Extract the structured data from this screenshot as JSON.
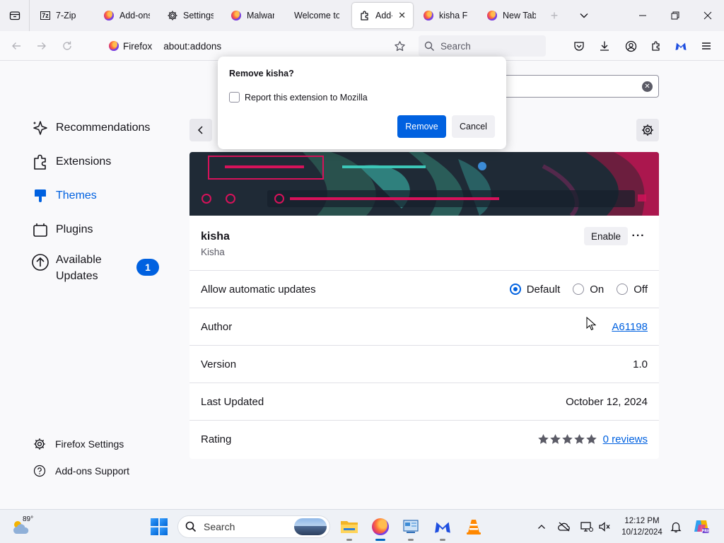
{
  "tabs": [
    {
      "label": "7-Zip",
      "icon": "7zip-icon"
    },
    {
      "label": "Add-ons",
      "icon": "firefox-icon"
    },
    {
      "label": "Settings",
      "icon": "gear-icon"
    },
    {
      "label": "Malware",
      "icon": "firefox-icon"
    },
    {
      "label": "Welcome to",
      "icon": "none"
    },
    {
      "label": "Add-o",
      "icon": "puzzle-icon",
      "active": true
    },
    {
      "label": "kisha Fu",
      "icon": "firefox-icon"
    },
    {
      "label": "New Tab",
      "icon": "firefox-icon"
    }
  ],
  "navbar": {
    "identity_label": "Firefox",
    "url": "about:addons",
    "search_placeholder": "Search"
  },
  "sidebar": {
    "items": [
      {
        "label": "Recommendations"
      },
      {
        "label": "Extensions"
      },
      {
        "label": "Themes",
        "selected": true
      },
      {
        "label": "Plugins"
      },
      {
        "label": "Available Updates",
        "label_line1": "Available",
        "label_line2": "Updates",
        "badge": "1"
      }
    ],
    "footer": [
      {
        "label": "Firefox Settings"
      },
      {
        "label": "Add-ons Support"
      }
    ]
  },
  "addon": {
    "name": "kisha",
    "creator": "Kisha",
    "enable_label": "Enable",
    "more_label": "···",
    "rows": {
      "updates": {
        "label": "Allow automatic updates",
        "options": [
          "Default",
          "On",
          "Off"
        ],
        "selected": "Default"
      },
      "author": {
        "label": "Author",
        "value": "A61198"
      },
      "version": {
        "label": "Version",
        "value": "1.0"
      },
      "last_updated": {
        "label": "Last Updated",
        "value": "October 12, 2024"
      },
      "rating": {
        "label": "Rating",
        "stars": 5,
        "reviews_link": "0 reviews"
      }
    }
  },
  "dialog": {
    "title": "Remove kisha?",
    "checkbox_label": "Report this extension to Mozilla",
    "checkbox_checked": false,
    "remove_label": "Remove",
    "cancel_label": "Cancel"
  },
  "taskbar": {
    "weather_temp": "89°",
    "search_label": "Search",
    "clock_time": "12:12 PM",
    "clock_date": "10/12/2024"
  },
  "colors": {
    "accent": "#0061e0",
    "theme_magenta": "#d6125a",
    "theme_teal": "#3cc6b8",
    "theme_dark": "#1f2a36"
  }
}
